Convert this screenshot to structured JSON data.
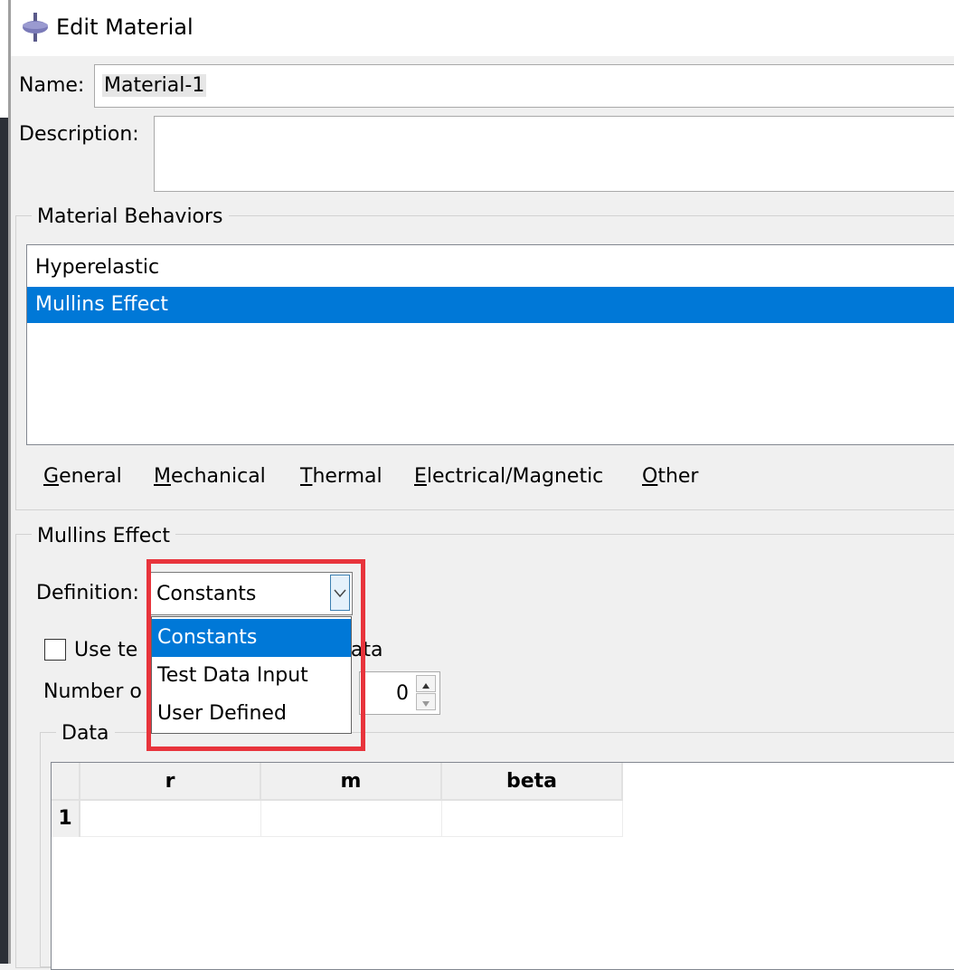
{
  "dialog": {
    "title": "Edit Material"
  },
  "name": {
    "label": "Name:",
    "value": "Material-1"
  },
  "description": {
    "label": "Description:",
    "value": ""
  },
  "behaviors": {
    "group_title": "Material Behaviors",
    "items": [
      {
        "label": "Hyperelastic",
        "selected": false
      },
      {
        "label": "Mullins Effect",
        "selected": true
      }
    ],
    "menus": [
      "General",
      "Mechanical",
      "Thermal",
      "Electrical/Magnetic",
      "Other"
    ]
  },
  "mullins": {
    "group_title": "Mullins Effect",
    "definition_label": "Definition:",
    "definition_value": "Constants",
    "dropdown_options": [
      "Constants",
      "Test Data Input",
      "User Defined"
    ],
    "checkbox_label_visible_start": "Use te",
    "checkbox_label_visible_end": "t data",
    "number_label_visible": "Number o",
    "number_value": "0",
    "data_group_title": "Data",
    "table": {
      "columns": [
        "r",
        "m",
        "beta"
      ],
      "rows": [
        {
          "index": "1",
          "cells": [
            "",
            "",
            ""
          ]
        }
      ]
    }
  },
  "colors": {
    "selection": "#0078d7",
    "highlight_box": "#e8343c"
  }
}
